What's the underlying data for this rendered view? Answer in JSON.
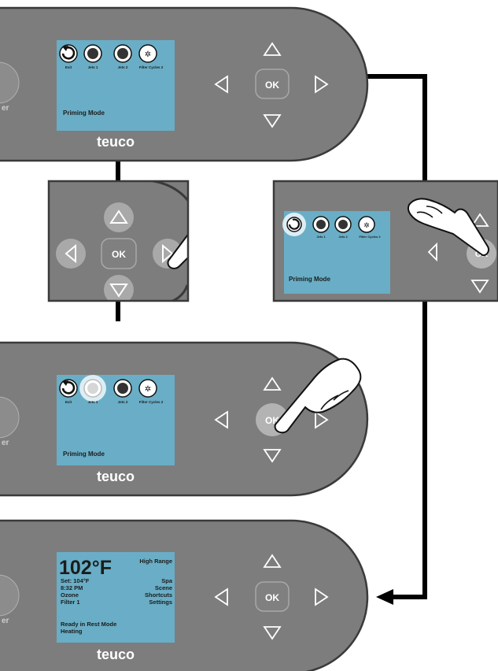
{
  "brand": "teuco",
  "side_label": "er",
  "ok_label": "OK",
  "colors": {
    "panel": "#7d7d7d",
    "panel_border": "#3a3a3a",
    "screen": "#69aec6",
    "button_dark": "#8c8c8c",
    "button_light": "#a9a9a9",
    "connector": "#000000"
  },
  "menu_screen": {
    "mode": "Priming Mode",
    "icons": [
      {
        "icon": "exit-icon",
        "label": "Exit"
      },
      {
        "icon": "jets-icon",
        "label": "Jets 1"
      },
      {
        "icon": "jets-icon",
        "label": "Jets 2"
      },
      {
        "icon": "filter-fan-icon",
        "label": "Filter Cycles 2"
      }
    ]
  },
  "home_screen": {
    "temperature": "102°F",
    "range": "High Range",
    "left_lines": [
      "Set: 104°F",
      "8:32 PM",
      "Ozone",
      "Filter 1"
    ],
    "right_lines": [
      "Spa",
      "Scene",
      "Shortcuts",
      "Settings"
    ],
    "status_lines": [
      "Ready in Rest Mode",
      "Heating"
    ]
  }
}
